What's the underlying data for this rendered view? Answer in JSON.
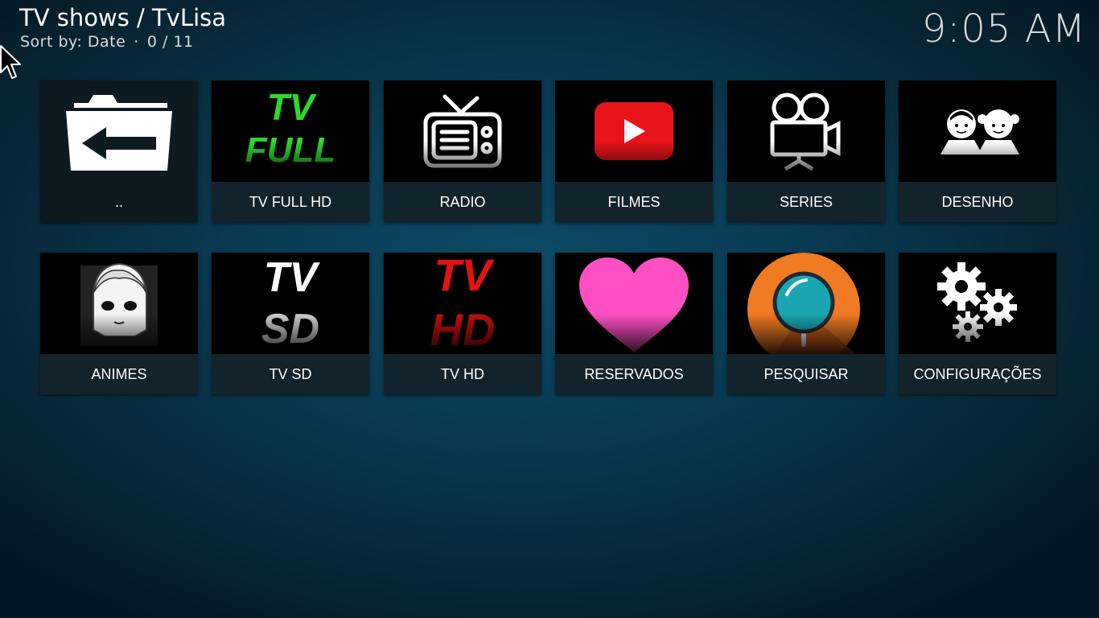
{
  "header": {
    "title": "TV shows / TvLisa",
    "sort_label": "Sort by: Date",
    "separator": "·",
    "count": "0 / 11"
  },
  "clock": "9:05 AM",
  "tiles": [
    {
      "label": "..",
      "icon": "back-folder-icon"
    },
    {
      "label": "TV FULL HD",
      "icon": "tv-full-logo",
      "art_line1": "TV",
      "art_line2": "FULL",
      "color": "#2bd92b"
    },
    {
      "label": "RADIO",
      "icon": "radio-tv-icon"
    },
    {
      "label": "FILMES",
      "icon": "play-button-icon",
      "color": "#e8141a"
    },
    {
      "label": "SERIES",
      "icon": "movie-camera-icon"
    },
    {
      "label": "DESENHO",
      "icon": "kids-icon"
    },
    {
      "label": "ANIMES",
      "icon": "anime-face-icon"
    },
    {
      "label": "TV SD",
      "icon": "tv-sd-logo",
      "art_line1": "TV",
      "art_line2": "SD",
      "color": "#ffffff"
    },
    {
      "label": "TV HD",
      "icon": "tv-hd-logo",
      "art_line1": "TV",
      "art_line2": "HD",
      "color": "#e3120f"
    },
    {
      "label": "RESERVADOS",
      "icon": "heart-icon",
      "color": "#ff4fc3"
    },
    {
      "label": "PESQUISAR",
      "icon": "search-icon",
      "color": "#f07a22"
    },
    {
      "label": "CONFIGURAÇÕES",
      "icon": "gears-icon"
    }
  ]
}
